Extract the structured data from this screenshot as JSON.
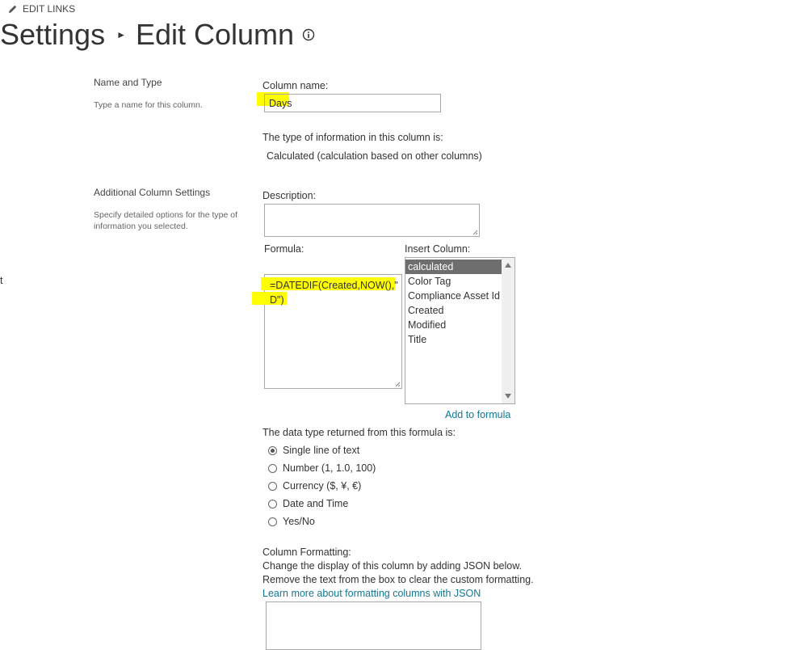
{
  "header": {
    "edit_links": "EDIT LINKS",
    "breadcrumb_root": "Settings",
    "page_title": "Edit Column"
  },
  "left_cut_text": "t",
  "name_type_section": {
    "title": "Name and Type",
    "description": "Type a name for this column.",
    "column_name_label": "Column name:",
    "column_name_value": "Days",
    "type_info_label": "The type of information in this column is:",
    "type_info_value": "Calculated (calculation based on other columns)"
  },
  "additional_section": {
    "title": "Additional Column Settings",
    "description_line1": "Specify detailed options for the type of",
    "description_line2": "information you selected.",
    "description_label": "Description:",
    "description_value": "",
    "formula_label": "Formula:",
    "formula_line1": "=DATEDIF(Created,NOW(),\"",
    "formula_line2": "D\")",
    "insert_column_label": "Insert Column:",
    "insert_columns": [
      "calculated",
      "Color Tag",
      "Compliance Asset Id",
      "Created",
      "Modified",
      "Title"
    ],
    "selected_column": "calculated",
    "add_to_formula": "Add to formula",
    "return_type_label": "The data type returned from this formula is:",
    "return_types": [
      {
        "label": "Single line of text",
        "checked": true
      },
      {
        "label": "Number (1, 1.0, 100)",
        "checked": false
      },
      {
        "label": "Currency ($, ¥, €)",
        "checked": false
      },
      {
        "label": "Date and Time",
        "checked": false
      },
      {
        "label": "Yes/No",
        "checked": false
      }
    ],
    "formatting_label": "Column Formatting:",
    "formatting_desc1": "Change the display of this column by adding JSON below.",
    "formatting_desc2": "Remove the text from the box to clear the custom formatting.",
    "formatting_link": "Learn more about formatting columns with JSON"
  },
  "colors": {
    "highlight": "#ffff00",
    "link": "#0f7895",
    "selected_item": "#6e6e6e"
  }
}
